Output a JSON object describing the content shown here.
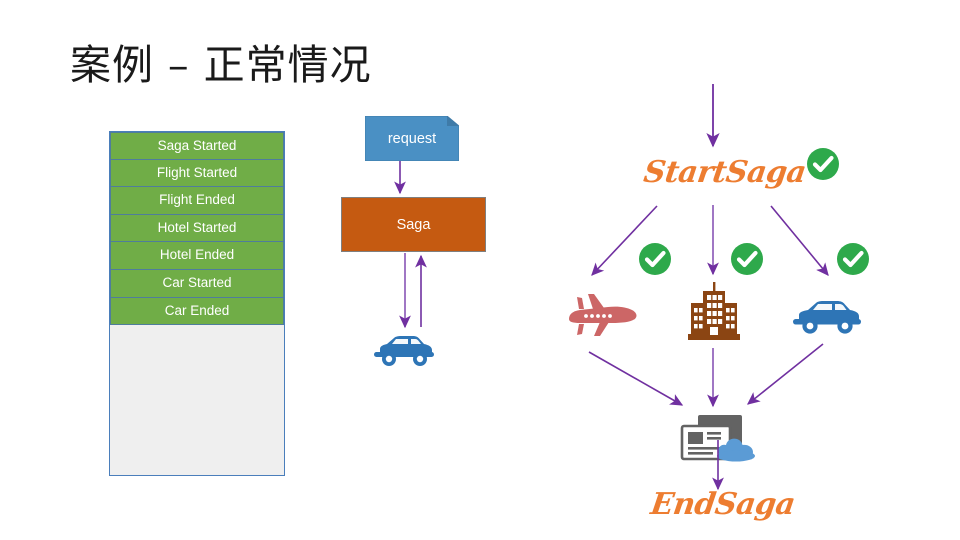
{
  "slide": {
    "title": "案例 – 正常情况",
    "background": "#ffffff"
  },
  "colors": {
    "green_row": "#70AD47",
    "row_border": "#4F7D9C",
    "panel_bg": "#EFEFEF",
    "panel_border": "#4A7EBB",
    "request_blue": "#4A90C4",
    "saga_orange": "#C55A11",
    "arrow_purple": "#7030A0",
    "saga_word_orange": "#ED7D31",
    "check_green": "#2EA94B",
    "plane_red": "#CC6666",
    "hotel_brown": "#8B4513",
    "car_blue": "#2E75B6"
  },
  "event_log": {
    "name": "event-log-panel",
    "rows": [
      "Saga Started",
      "Flight Started",
      "Flight Ended",
      "Hotel Started",
      "Hotel Ended",
      "Car Started",
      "Car Ended"
    ]
  },
  "flow": {
    "request_label": "request",
    "saga_label": "Saga",
    "car_icon": "car-icon"
  },
  "saga_diagram": {
    "start_label": "StartSaga",
    "end_label": "EndSaga",
    "services": [
      {
        "icon": "airplane-icon",
        "status": "check-icon"
      },
      {
        "icon": "hotel-building-icon",
        "status": "check-icon"
      },
      {
        "icon": "car-icon",
        "status": "check-icon"
      }
    ],
    "start_status": "check-icon",
    "result_icon": "document-cloud-icon"
  }
}
